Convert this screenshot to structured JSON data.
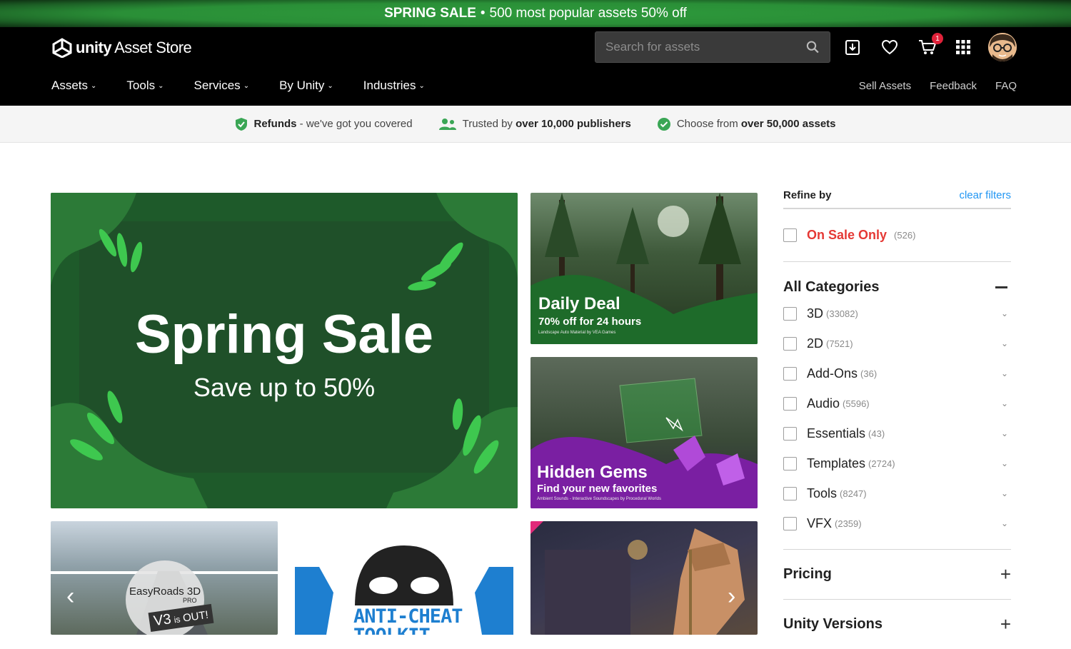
{
  "promo": {
    "label": "SPRING SALE",
    "sep": "•",
    "text": "500 most popular assets 50% off"
  },
  "header": {
    "logo_brand": "unity",
    "logo_product": "Asset Store",
    "search_placeholder": "Search for assets",
    "cart_count": "1",
    "nav": [
      "Assets",
      "Tools",
      "Services",
      "By Unity",
      "Industries"
    ],
    "right_nav": [
      "Sell Assets",
      "Feedback",
      "FAQ"
    ]
  },
  "trust": {
    "refunds_bold": "Refunds",
    "refunds_rest": " - we've got you covered",
    "trusted_pre": "Trusted by ",
    "trusted_bold": "over 10,000 publishers",
    "choose_pre": "Choose from ",
    "choose_bold": "over 50,000 assets"
  },
  "tiles": {
    "hero_title": "Spring Sale",
    "hero_sub": "Save up to 50%",
    "deal_title": "Daily Deal",
    "deal_sub": "70% off for 24 hours",
    "deal_small": "Landscape Auto Material by VEA Games",
    "gems_title": "Hidden Gems",
    "gems_sub": "Find your new favorites",
    "gems_small": "Ambient Sounds - Interactive Soundscapes by Procedural Worlds",
    "road_brand": "EasyRoads 3D",
    "road_pro": "PRO",
    "road_v3": "V3",
    "road_is": "is",
    "road_out": "OUT!",
    "anti_text": "ANTI-CHEAT",
    "anti_text2": "TOOLKIT"
  },
  "sidebar": {
    "refine": "Refine by",
    "clear": "clear filters",
    "on_sale": "On Sale Only",
    "on_sale_count": "(526)",
    "categories_title": "All Categories",
    "categories": [
      {
        "name": "3D",
        "count": "(33082)"
      },
      {
        "name": "2D",
        "count": "(7521)"
      },
      {
        "name": "Add-Ons",
        "count": "(36)"
      },
      {
        "name": "Audio",
        "count": "(5596)"
      },
      {
        "name": "Essentials",
        "count": "(43)"
      },
      {
        "name": "Templates",
        "count": "(2724)"
      },
      {
        "name": "Tools",
        "count": "(8247)"
      },
      {
        "name": "VFX",
        "count": "(2359)"
      }
    ],
    "pricing": "Pricing",
    "versions": "Unity Versions"
  },
  "colors": {
    "accent": "#2196f3",
    "sale": "#e53935",
    "promo_green": "#2e9a3c"
  }
}
